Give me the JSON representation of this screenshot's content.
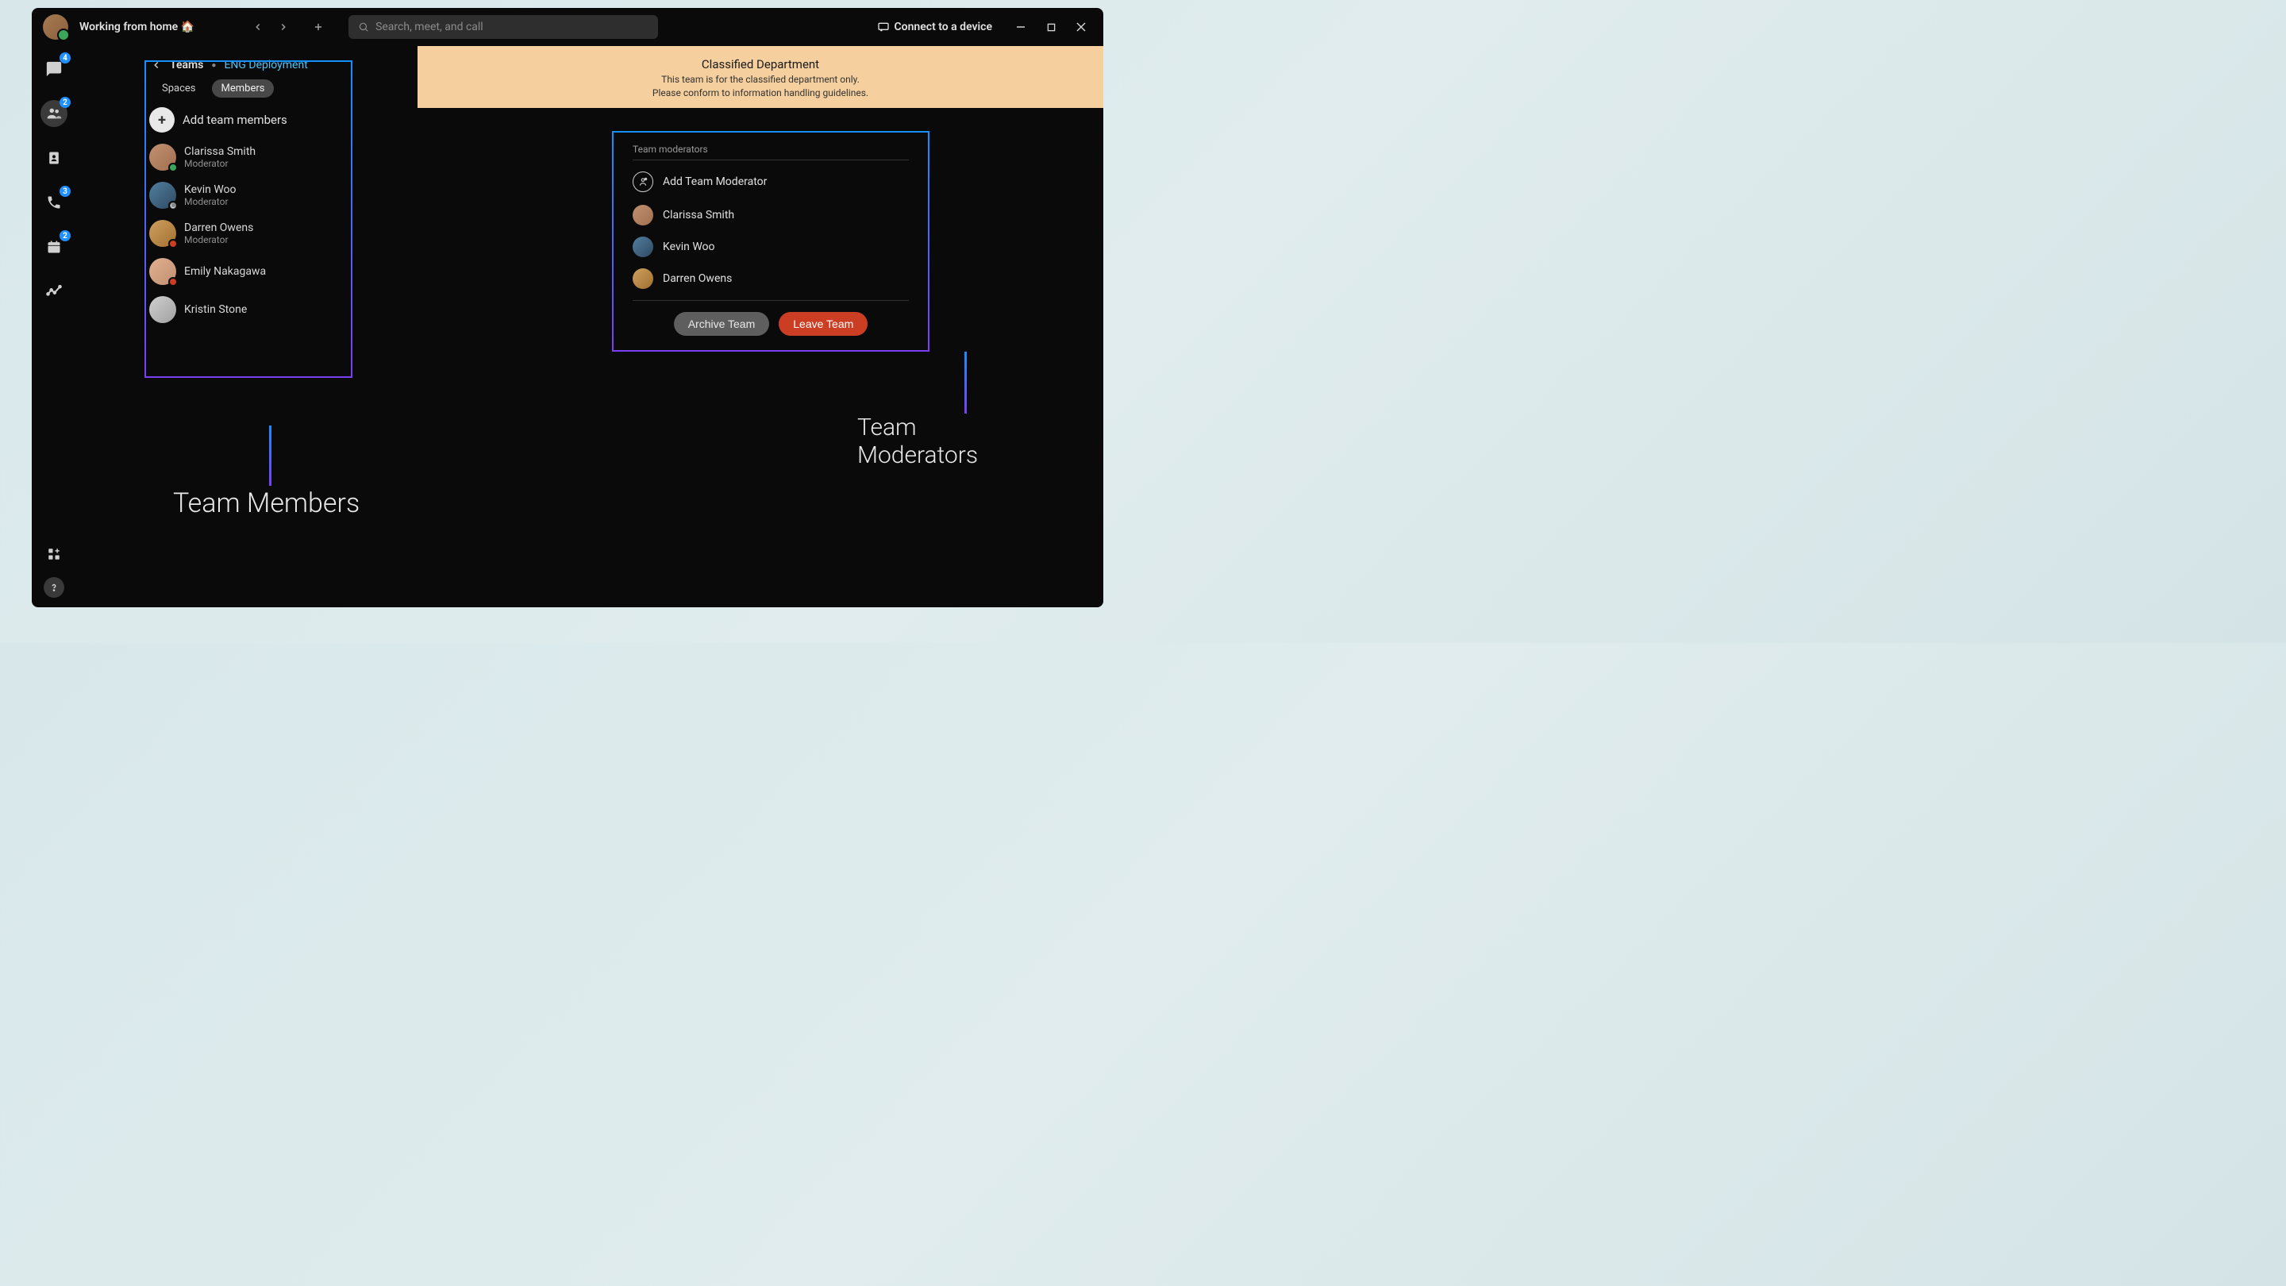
{
  "titlebar": {
    "status": "Working from home 🏠",
    "search_placeholder": "Search, meet, and call",
    "connect": "Connect to a device"
  },
  "rail": {
    "badges": {
      "chat": "4",
      "teams": "2",
      "calls": "3",
      "calendar": "2"
    }
  },
  "sidebar": {
    "back_label": "Teams",
    "current": "ENG Deployment",
    "tabs": {
      "spaces": "Spaces",
      "members": "Members"
    },
    "add_members": "Add team members",
    "members_list": [
      {
        "name": "Clarissa Smith",
        "role": "Moderator",
        "status": "green",
        "av": "av1"
      },
      {
        "name": "Kevin Woo",
        "role": "Moderator",
        "status": "away",
        "av": "av2"
      },
      {
        "name": "Darren Owens",
        "role": "Moderator",
        "status": "call",
        "av": "av3"
      },
      {
        "name": "Emily Nakagawa",
        "role": "",
        "status": "call",
        "av": "av4"
      },
      {
        "name": "Kristin Stone",
        "role": "",
        "status": "",
        "av": "av5"
      }
    ]
  },
  "banner": {
    "title": "Classified Department",
    "line1": "This team is for the classified department only.",
    "line2": "Please conform to information handling guidelines."
  },
  "moderators": {
    "header": "Team moderators",
    "add": "Add Team Moderator",
    "list": [
      {
        "name": "Clarissa Smith",
        "av": "av1"
      },
      {
        "name": "Kevin Woo",
        "av": "av2"
      },
      {
        "name": "Darren Owens",
        "av": "av3"
      }
    ],
    "archive": "Archive Team",
    "leave": "Leave Team"
  },
  "callouts": {
    "members": "Team Members",
    "moderators": "Team Moderators"
  }
}
